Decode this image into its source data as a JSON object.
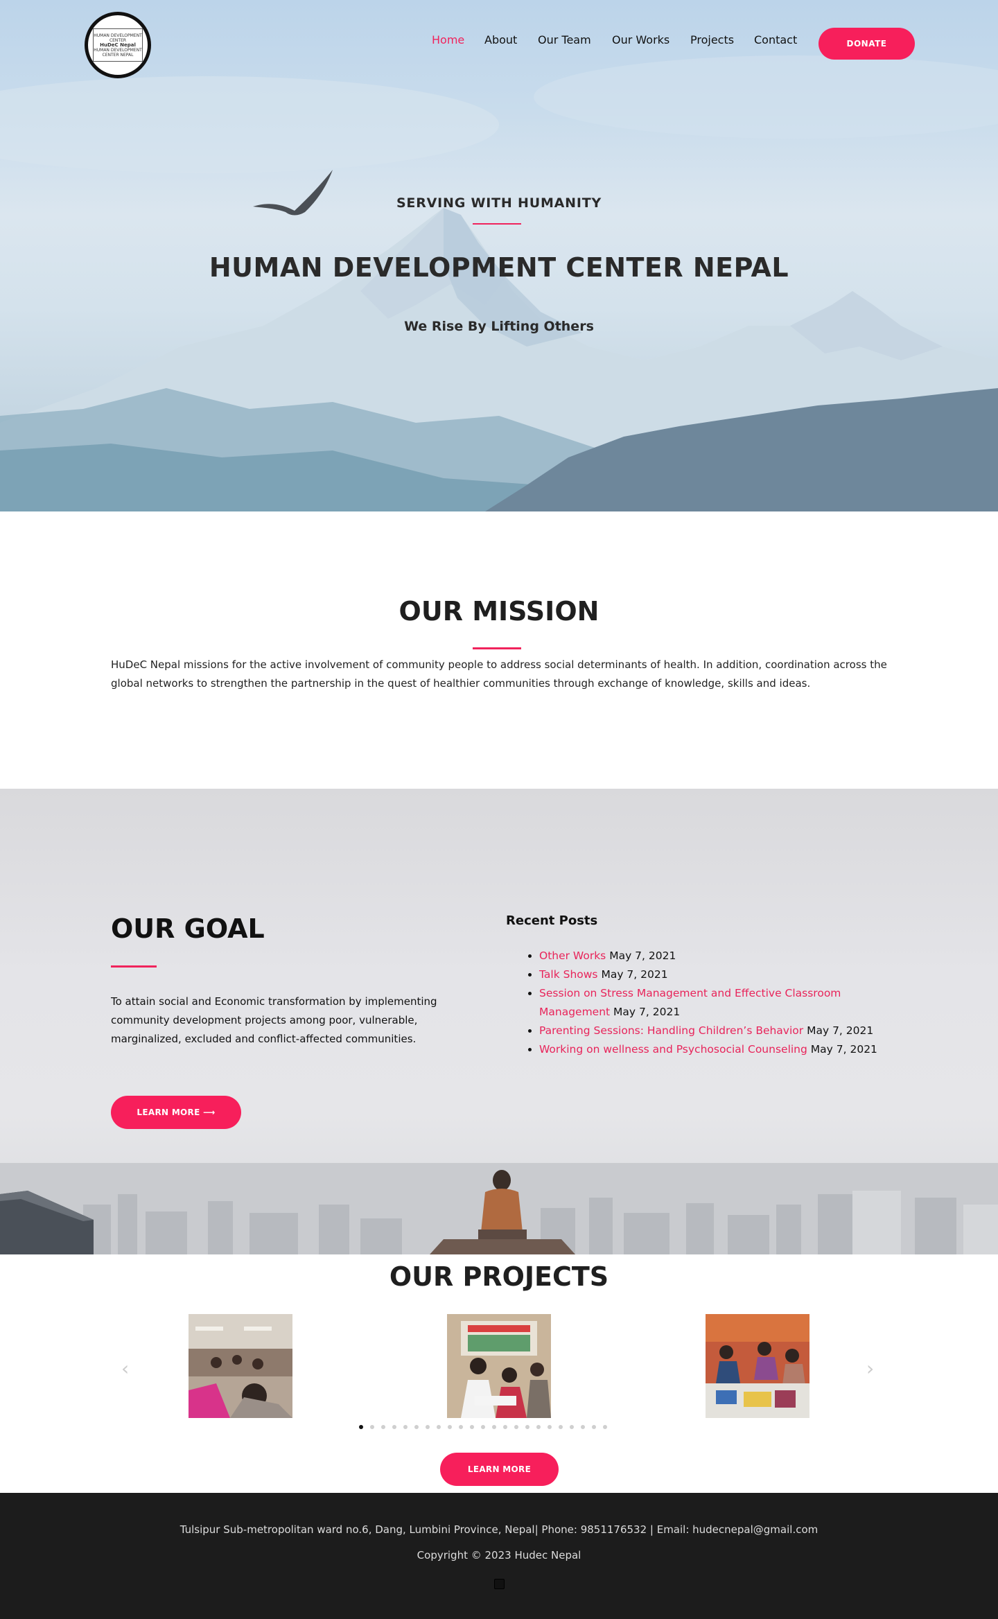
{
  "header": {
    "logo_text": [
      "HUMAN DEVELOPMENT CENTER",
      "HuDeC Nepal",
      "HUMAN DEVELOPMENT CENTER NEPAL"
    ],
    "nav": [
      {
        "label": "Home",
        "active": true
      },
      {
        "label": "About",
        "active": false
      },
      {
        "label": "Our Team",
        "active": false
      },
      {
        "label": "Our Works",
        "active": false
      },
      {
        "label": "Projects",
        "active": false
      },
      {
        "label": "Contact",
        "active": false
      }
    ],
    "donate_label": "DONATE"
  },
  "hero": {
    "eyebrow": "SERVING WITH HUMANITY",
    "title": "HUMAN DEVELOPMENT CENTER NEPAL",
    "subtitle": "We Rise By Lifting Others"
  },
  "mission": {
    "title": "OUR MISSION",
    "text": "HuDeC Nepal missions for the active involvement of community people to address social determinants of health. In addition, coordination across the global networks to strengthen the partnership in the quest of healthier communities through exchange of knowledge, skills and ideas."
  },
  "goal": {
    "title": "OUR GOAL",
    "text": "To attain social and Economic transformation by implementing community development projects among poor, vulnerable, marginalized, excluded and conflict-affected communities.",
    "button_label": "LEARN MORE ⟶"
  },
  "recent_posts": {
    "title": "Recent Posts",
    "items": [
      {
        "title": "Other Works",
        "date": "May 7, 2021"
      },
      {
        "title": "Talk Shows",
        "date": "May 7, 2021"
      },
      {
        "title": "Session on Stress Management and Effective Classroom Management",
        "date": "May 7, 2021"
      },
      {
        "title": "Parenting Sessions: Handling Children’s Behavior",
        "date": "May 7, 2021"
      },
      {
        "title": "Working on wellness and Psychosocial Counseling",
        "date": "May 7, 2021"
      }
    ]
  },
  "projects": {
    "title": "OUR PROJECTS",
    "prev_icon": "‹",
    "next_icon": "›",
    "dot_count": 23,
    "active_dot": 0,
    "button_label": "LEARN MORE"
  },
  "footer": {
    "address": "Tulsipur Sub-metropolitan ward no.6, Dang, Lumbini Province, Nepal| Phone: 9851176532 | Email: hudecnepal@gmail.com",
    "copyright": "Copyright © 2023 Hudec Nepal",
    "social_icon": "facebook-icon"
  },
  "colors": {
    "accent": "#f71f5b",
    "link": "#e8245a",
    "footer_bg": "#1c1c1c"
  }
}
